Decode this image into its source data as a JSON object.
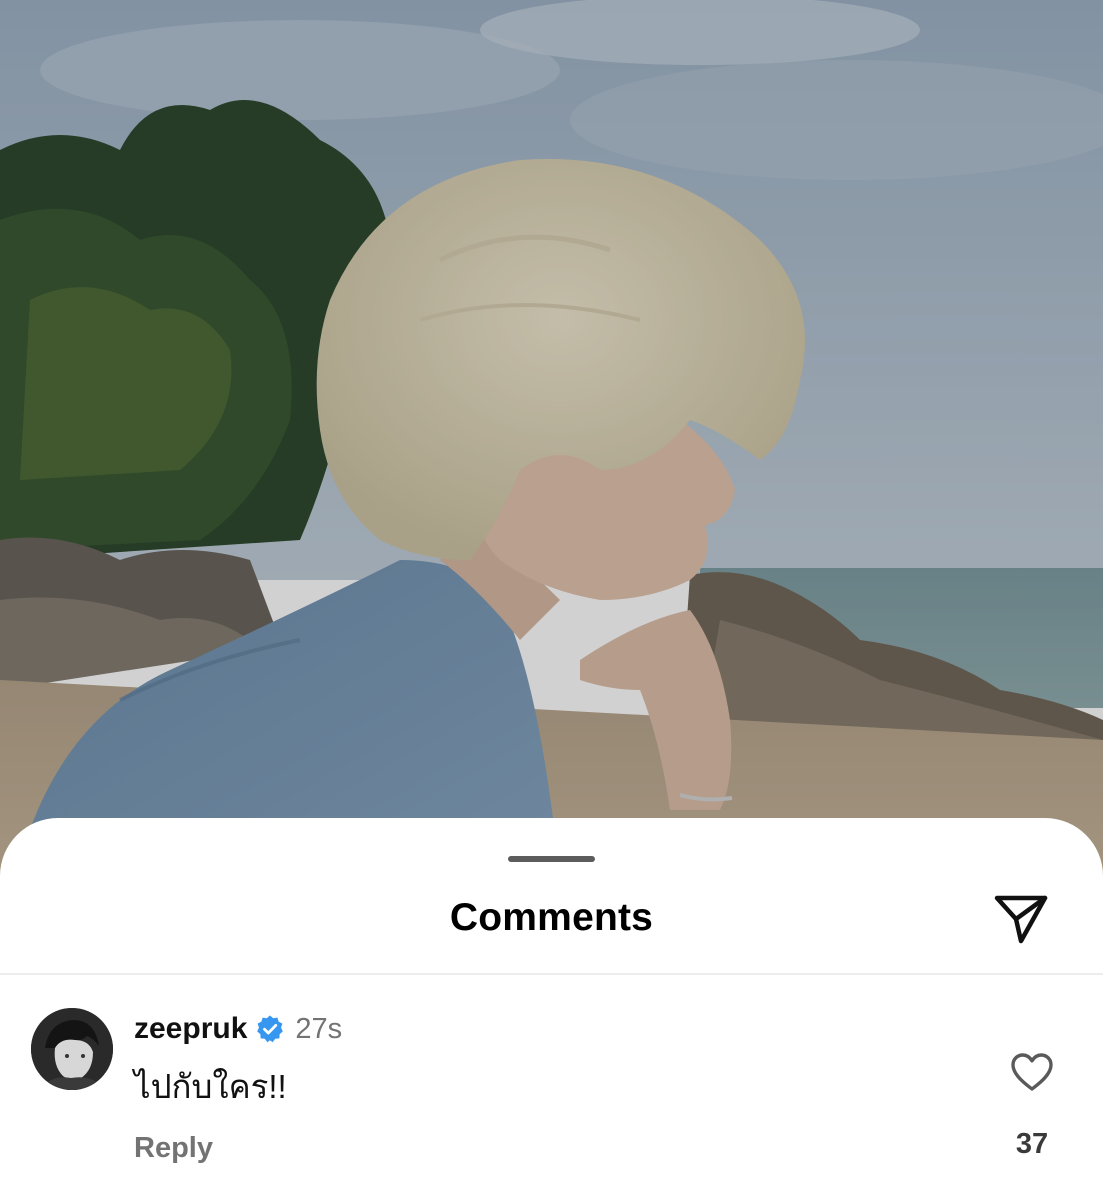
{
  "post": {
    "photo": "beach-portrait-photo"
  },
  "sheet": {
    "title": "Comments",
    "share_icon": "paper-plane-icon"
  },
  "comments": [
    {
      "username": "zeepruk",
      "verified": true,
      "timestamp": "27s",
      "text": "ไปกับใคร!!",
      "reply_label": "Reply",
      "like_count": "37",
      "like_icon": "heart-outline-icon"
    }
  ],
  "colors": {
    "verified_blue": "#3797f0",
    "secondary_text": "#737373",
    "primary_text": "#111111"
  }
}
